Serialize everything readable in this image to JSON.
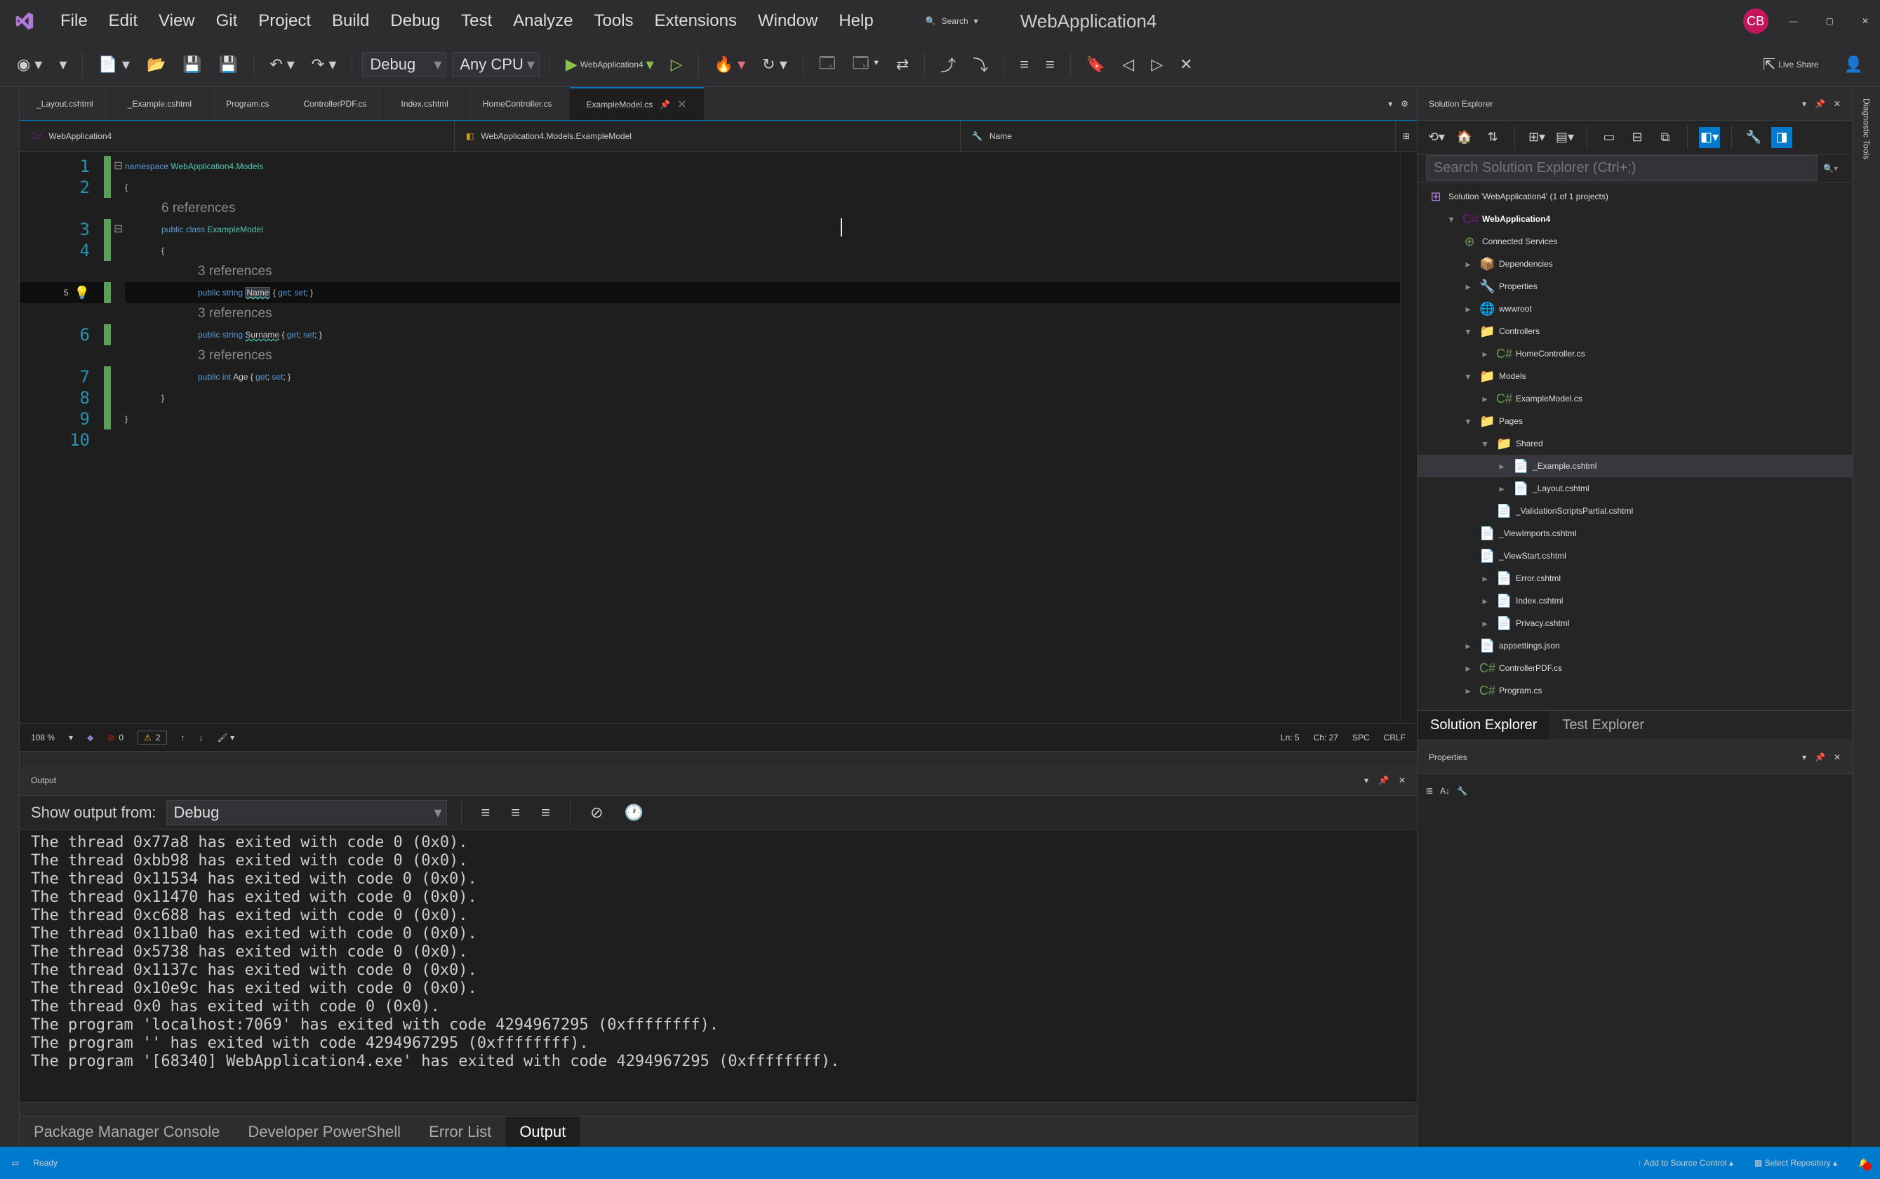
{
  "title": "WebApplication4",
  "avatar": "CB",
  "menu": {
    "file": "File",
    "edit": "Edit",
    "view": "View",
    "git": "Git",
    "project": "Project",
    "build": "Build",
    "debug": "Debug",
    "test": "Test",
    "analyze": "Analyze",
    "tools": "Tools",
    "extensions": "Extensions",
    "window": "Window",
    "help": "Help"
  },
  "search": {
    "label": "Search"
  },
  "toolbar": {
    "config": "Debug",
    "platform": "Any CPU",
    "launch": "WebApplication4",
    "liveshare": "Live Share"
  },
  "tabs": [
    {
      "label": "_Layout.cshtml"
    },
    {
      "label": "_Example.cshtml"
    },
    {
      "label": "Program.cs"
    },
    {
      "label": "ControllerPDF.cs"
    },
    {
      "label": "Index.cshtml"
    },
    {
      "label": "HomeController.cs"
    },
    {
      "label": "ExampleModel.cs",
      "active": true
    }
  ],
  "nav": {
    "scope": "WebApplication4",
    "class": "WebApplication4.Models.ExampleModel",
    "member": "Name"
  },
  "code": {
    "ns": "namespace",
    "nsname": "WebApplication4.Models",
    "refs6": "6 references",
    "refs3": "3 references",
    "pub": "public",
    "cls": "class",
    "clsname": "ExampleModel",
    "str": "string",
    "intk": "int",
    "n": "Name",
    "s": "Surname",
    "a": "Age",
    "get": "get",
    "set": "set"
  },
  "lines": [
    "1",
    "2",
    "3",
    "4",
    "5",
    "6",
    "7",
    "8",
    "9",
    "10"
  ],
  "ed_status": {
    "zoom": "108 %",
    "err": "0",
    "warn": "2",
    "pos": "Ln: 5",
    "ch": "Ch: 27",
    "ins": "SPC",
    "eol": "CRLF"
  },
  "output": {
    "title": "Output",
    "from_label": "Show output from:",
    "from": "Debug",
    "lines": [
      "The thread 0x77a8 has exited with code 0 (0x0).",
      "The thread 0xbb98 has exited with code 0 (0x0).",
      "The thread 0x11534 has exited with code 0 (0x0).",
      "The thread 0x11470 has exited with code 0 (0x0).",
      "The thread 0xc688 has exited with code 0 (0x0).",
      "The thread 0x11ba0 has exited with code 0 (0x0).",
      "The thread 0x5738 has exited with code 0 (0x0).",
      "The thread 0x1137c has exited with code 0 (0x0).",
      "The thread 0x10e9c has exited with code 0 (0x0).",
      "The thread 0x0 has exited with code 0 (0x0).",
      "The program 'localhost:7069' has exited with code 4294967295 (0xffffffff).",
      "The program '' has exited with code 4294967295 (0xffffffff).",
      "The program '[68340] WebApplication4.exe' has exited with code 4294967295 (0xffffffff)."
    ]
  },
  "panel_tabs": {
    "pmc": "Package Manager Console",
    "ps": "Developer PowerShell",
    "el": "Error List",
    "out": "Output"
  },
  "se": {
    "title": "Solution Explorer",
    "search_ph": "Search Solution Explorer (Ctrl+;)",
    "sln": "Solution 'WebApplication4' (1 of 1 projects)",
    "proj": "WebApplication4",
    "nodes": {
      "connected": "Connected Services",
      "deps": "Dependencies",
      "props": "Properties",
      "wwwroot": "wwwroot",
      "controllers": "Controllers",
      "hc": "HomeController.cs",
      "models": "Models",
      "em": "ExampleModel.cs",
      "pages": "Pages",
      "shared": "Shared",
      "ex": "_Example.cshtml",
      "lay": "_Layout.cshtml",
      "vsp": "_ValidationScriptsPartial.cshtml",
      "vi": "_ViewImports.cshtml",
      "vs": "_ViewStart.cshtml",
      "err": "Error.cshtml",
      "idx": "Index.cshtml",
      "priv": "Privacy.cshtml",
      "app": "appsettings.json",
      "cpdf": "ControllerPDF.cs",
      "prog": "Program.cs"
    },
    "bottabs": {
      "se": "Solution Explorer",
      "te": "Test Explorer"
    }
  },
  "props": {
    "title": "Properties"
  },
  "status": {
    "ready": "Ready",
    "asc": "Add to Source Control",
    "repo": "Select Repository"
  },
  "rightvert": {
    "diag": "Diagnostic Tools"
  }
}
